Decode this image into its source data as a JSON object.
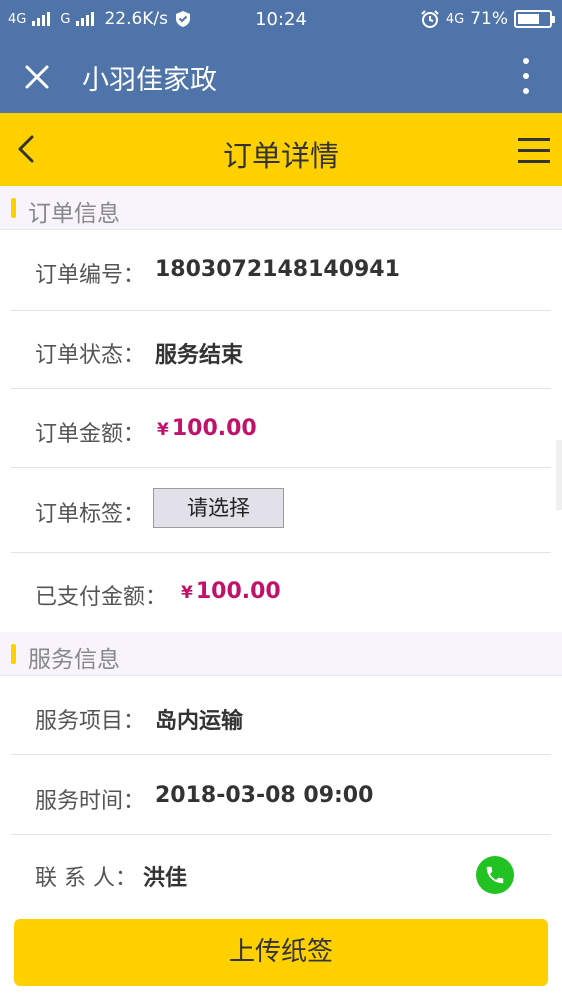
{
  "status_bar": {
    "net1": "4G",
    "net2": "G",
    "speed": "22.6K/s",
    "time": "10:24",
    "net3": "4G",
    "battery": "71%",
    "battery_level": 0.71
  },
  "app_bar": {
    "title": "小羽佳家政",
    "icons": [
      "close-icon",
      "more-vertical-icon"
    ]
  },
  "page_header": {
    "title": "订单详情",
    "icons": [
      "back-chevron-icon",
      "menu-icon"
    ]
  },
  "order_info": {
    "section_title": "订单信息",
    "order_no_label": "订单编号：",
    "order_no": "1803072148140941",
    "status_label": "订单状态：",
    "status": "服务结束",
    "amount_label": "订单金额：",
    "amount_currency": "¥",
    "amount": "100.00",
    "tag_label": "订单标签：",
    "tag_select": "请选择",
    "paid_label": "已支付金额：",
    "paid_currency": "¥",
    "paid": "100.00"
  },
  "service_info": {
    "section_title": "服务信息",
    "item_label": "服务项目：",
    "item": "岛内运输",
    "time_label": "服务时间：",
    "time": "2018-03-08 09:00",
    "contact_label": "联 系 人：",
    "contact": "洪佳"
  },
  "actions": {
    "upload_button": "上传纸签"
  },
  "colors": {
    "header_blue": "#4f74aa",
    "accent_yellow": "#ffd000",
    "money": "#c0126b",
    "phone_green": "#21c221"
  }
}
